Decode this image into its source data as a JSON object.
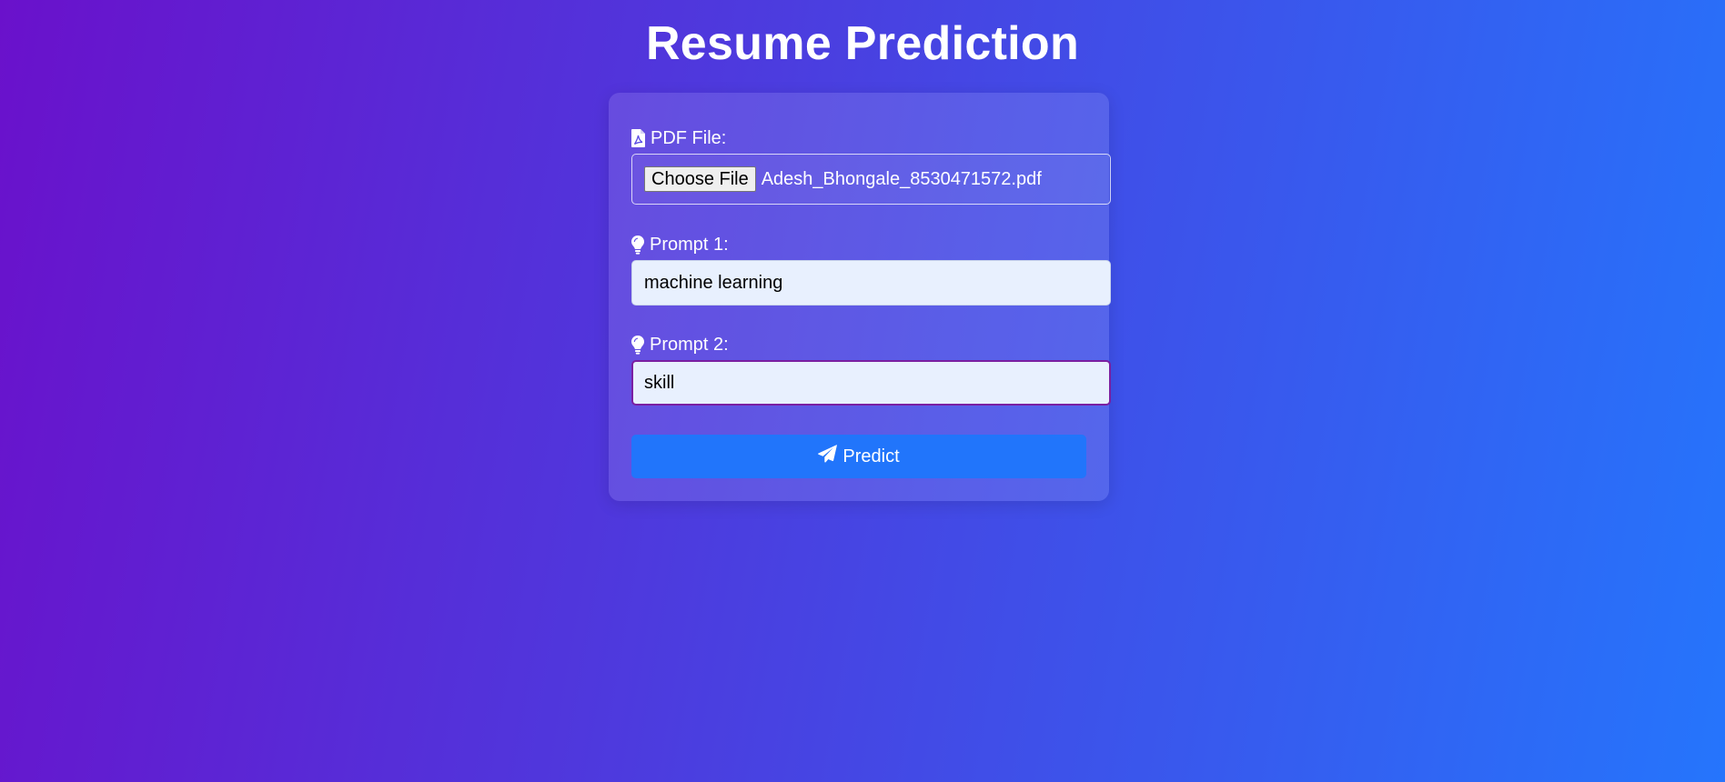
{
  "page": {
    "title": "Resume Prediction"
  },
  "form": {
    "pdf_label": "PDF File:",
    "pdf_icon": "file-pdf-icon",
    "choose_file_label": "Choose File",
    "file_name": "Adesh_Bhongale_8530471572.pdf",
    "prompt1_label": "Prompt 1:",
    "prompt1_icon": "lightbulb-icon",
    "prompt1_value": "machine learning",
    "prompt2_label": "Prompt 2:",
    "prompt2_icon": "lightbulb-icon",
    "prompt2_value": "skill",
    "submit_label": "Predict",
    "submit_icon": "paper-plane-icon"
  },
  "colors": {
    "gradient_start": "#6a11cb",
    "gradient_end": "#2575fc",
    "button": "#2175fb",
    "input_bg": "#e8f0fe",
    "focus_border": "#7a1fa2"
  }
}
